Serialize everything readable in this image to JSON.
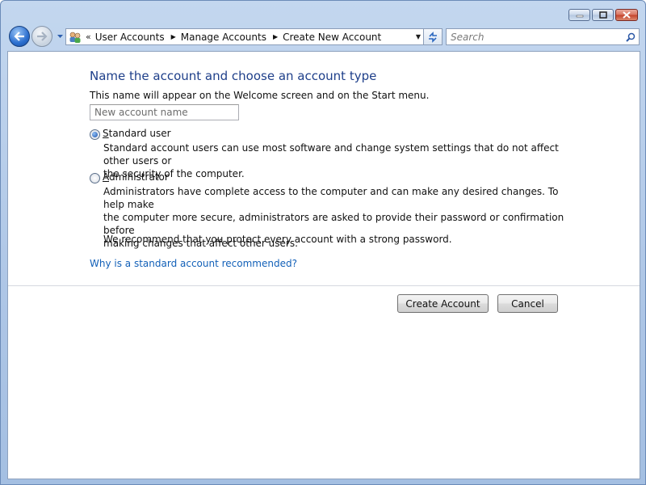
{
  "window": {
    "controls": {
      "minimize_icon": "minimize-icon",
      "maximize_icon": "maximize-icon",
      "close_icon": "close-icon"
    }
  },
  "toolbar": {
    "breadcrumb_overflow": "«",
    "breadcrumbs": [
      {
        "label": "User Accounts"
      },
      {
        "label": "Manage Accounts"
      },
      {
        "label": "Create New Account"
      }
    ],
    "search_placeholder": "Search"
  },
  "main": {
    "title": "Name the account and choose an account type",
    "subtitle": "This name will appear on the Welcome screen and on the Start menu.",
    "name_placeholder": "New account name",
    "options": [
      {
        "label": "Standard user",
        "accesskey": "S",
        "selected": true,
        "description_lines": [
          "Standard account users can use most software and change system settings that do not affect other users or",
          "the security of the computer."
        ]
      },
      {
        "label": "Administrator",
        "accesskey": "A",
        "selected": false,
        "description_lines": [
          "Administrators have complete access to the computer and can make any desired changes. To help make",
          "the computer more secure, administrators are asked to provide their password or confirmation before",
          "making changes that affect other users."
        ]
      }
    ],
    "recommendation": "We recommend that you protect every account with a strong password.",
    "help_link": "Why is a standard account recommended?"
  },
  "buttons": {
    "create": "Create Account",
    "cancel": "Cancel"
  },
  "colors": {
    "title": "#1e3f8a",
    "link": "#1260b8",
    "frame": "#aec6e6"
  }
}
